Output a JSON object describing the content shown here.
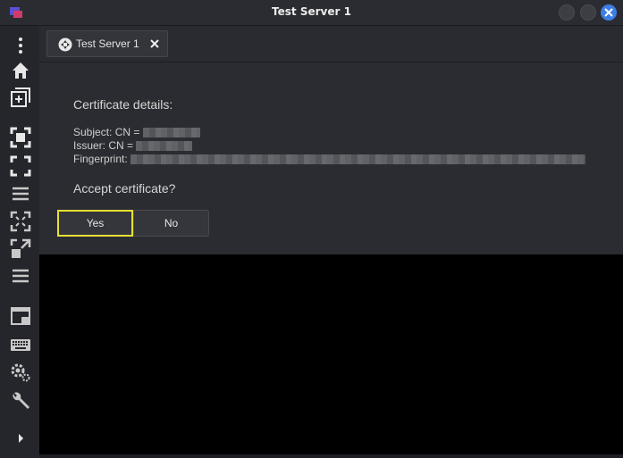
{
  "window": {
    "title": "Test Server 1"
  },
  "tab": {
    "label": "Test Server 1"
  },
  "dialog": {
    "heading": "Certificate details:",
    "subject_label": "Subject: CN =",
    "issuer_label": "Issuer: CN =",
    "fingerprint_label": "Fingerprint:",
    "question": "Accept certificate?",
    "yes_label": "Yes",
    "no_label": "No"
  },
  "sidebar": {
    "icons": [
      "more-vertical-icon",
      "home-icon",
      "new-connection-icon",
      "fullscreen-icon",
      "fit-screen-icon",
      "menu-icon",
      "scale-down-icon",
      "scale-up-icon",
      "list-icon",
      "window-mode-icon",
      "keyboard-icon",
      "settings-icon",
      "tools-icon",
      "expand-arrow-icon"
    ]
  },
  "colors": {
    "accent": "#3d7ee6",
    "focus": "#e6e033",
    "display": "#000000"
  }
}
